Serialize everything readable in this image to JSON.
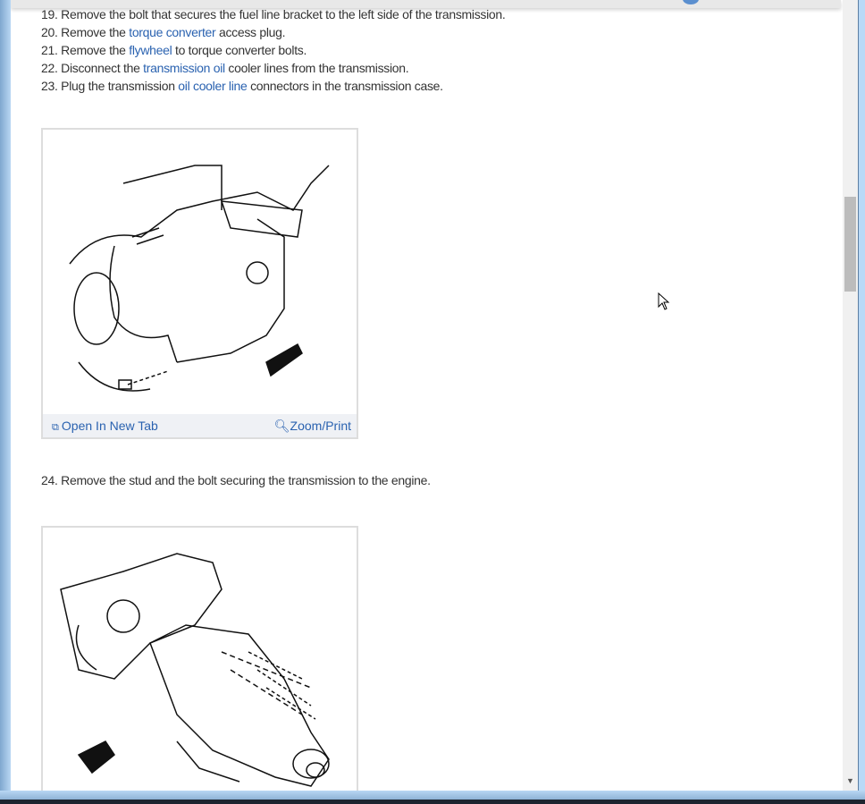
{
  "steps": [
    {
      "num": "19.",
      "parts": [
        {
          "t": "Remove the bolt that secures the fuel line bracket to the left side of the transmission."
        }
      ]
    },
    {
      "num": "20.",
      "parts": [
        {
          "t": "Remove the "
        },
        {
          "t": "torque converter",
          "link": true
        },
        {
          "t": " access plug."
        }
      ]
    },
    {
      "num": "21.",
      "parts": [
        {
          "t": "Remove the "
        },
        {
          "t": "flywheel",
          "link": true
        },
        {
          "t": " to torque converter bolts."
        }
      ]
    },
    {
      "num": "22.",
      "parts": [
        {
          "t": "Disconnect the "
        },
        {
          "t": "transmission oil",
          "link": true
        },
        {
          "t": " cooler lines from the transmission."
        }
      ]
    },
    {
      "num": "23.",
      "parts": [
        {
          "t": "Plug the transmission "
        },
        {
          "t": "oil cooler line",
          "link": true
        },
        {
          "t": " connectors in the transmission case."
        }
      ]
    }
  ],
  "step24": "24. Remove the stud and the bolt securing the transmission to the engine.",
  "figure": {
    "open_label": "Open In New Tab",
    "zoom_label": "Zoom/Print"
  },
  "colors": {
    "link": "#2a62b0",
    "text": "#333333"
  }
}
